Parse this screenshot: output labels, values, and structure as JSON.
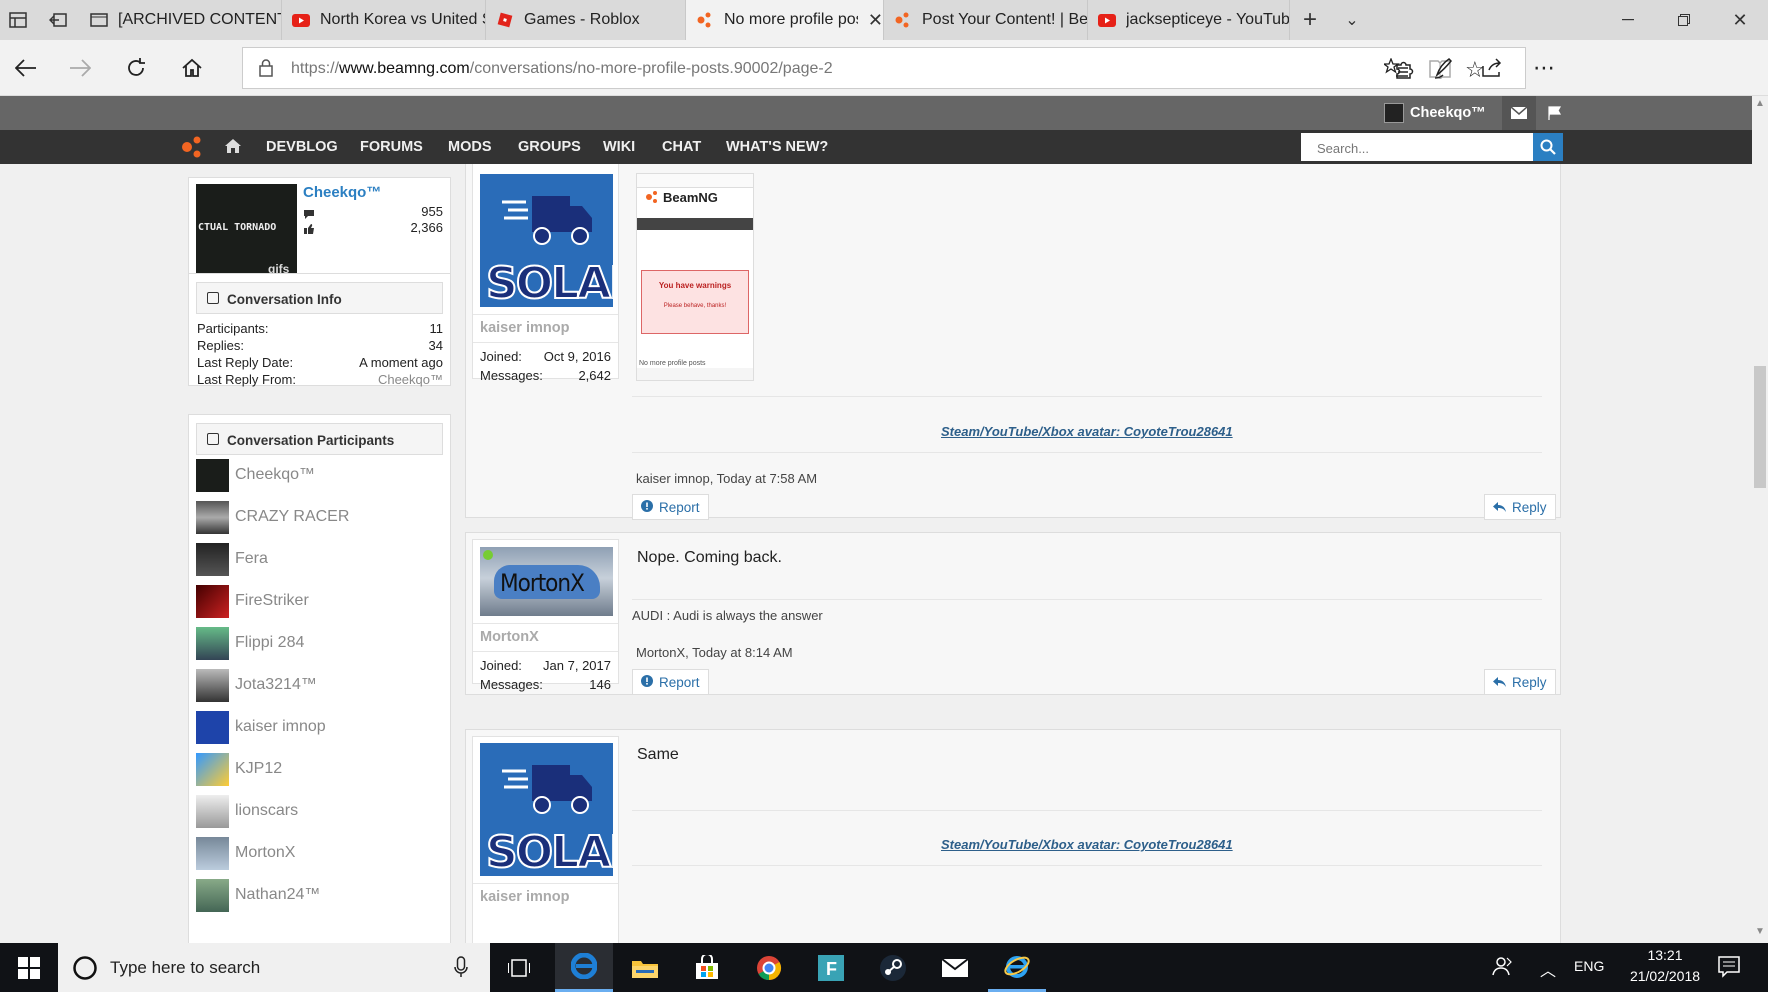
{
  "tabs": [
    {
      "label": "[ARCHIVED CONTENT] E",
      "icon": "page-icon"
    },
    {
      "label": "North Korea vs United St",
      "icon": "youtube-icon"
    },
    {
      "label": "Games - Roblox",
      "icon": "roblox-icon"
    },
    {
      "label": "No more profile post",
      "icon": "beamng-icon",
      "active": true
    },
    {
      "label": "Post Your Content! | Bear",
      "icon": "beamng-icon"
    },
    {
      "label": "jacksepticeye - YouTube",
      "icon": "youtube-icon"
    }
  ],
  "address": {
    "prefix": "https://",
    "domain": "www.beamng.com",
    "path": "/conversations/no-more-profile-posts.90002/page-2"
  },
  "site": {
    "account_name": "Cheekqo™",
    "nav": [
      "DEVBLOG",
      "FORUMS",
      "MODS",
      "GROUPS",
      "WIKI",
      "CHAT",
      "WHAT'S NEW?"
    ],
    "search_placeholder": "Search..."
  },
  "profile": {
    "name": "Cheekqo™",
    "messages": "955",
    "likes": "2,366",
    "avatar_text": "CTUAL TORNADO",
    "avatar_sub": "gifs"
  },
  "conversation_info": {
    "title": "Conversation Info",
    "rows": [
      {
        "label": "Participants:",
        "value": "11"
      },
      {
        "label": "Replies:",
        "value": "34"
      },
      {
        "label": "Last Reply Date:",
        "value": "A moment ago"
      },
      {
        "label": "Last Reply From:",
        "value": "Cheekqo™"
      }
    ]
  },
  "participants": {
    "title": "Conversation Participants",
    "list": [
      "Cheekqo™",
      "CRAZY RACER",
      "Fera",
      "FireStriker",
      "Flippi 284",
      "Jota3214™",
      "kaiser imnop",
      "KJP12",
      "lionscars",
      "MortonX",
      "Nathan24™"
    ]
  },
  "posts": [
    {
      "user": "kaiser imnop",
      "joined_label": "Joined:",
      "joined": "Oct 9, 2016",
      "messages_label": "Messages:",
      "messages": "2,642",
      "avatar": "SOLAR",
      "screenshot": {
        "logo": "BeamNG",
        "warn_title": "You have warnings",
        "warn_text": "Please behave, thanks!",
        "footer": "No more profile posts"
      },
      "signature": "Steam/YouTube/Xbox avatar: CoyoteTrou28641",
      "meta": "kaiser imnop, Today at 7:58 AM",
      "report": "Report",
      "reply": "Reply"
    },
    {
      "user": "MortonX",
      "joined_label": "Joined:",
      "joined": "Jan 7, 2017",
      "messages_label": "Messages:",
      "messages": "146",
      "avatar": "MortonX",
      "text": "Nope. Coming back.",
      "signature": "AUDI : Audi is always the answer",
      "meta": "MortonX, Today at 8:14 AM",
      "report": "Report",
      "reply": "Reply"
    },
    {
      "user": "kaiser imnop",
      "avatar": "SOLAR",
      "text": "Same",
      "signature": "Steam/YouTube/Xbox avatar: CoyoteTrou28641"
    }
  ],
  "taskbar": {
    "search_placeholder": "Type here to search",
    "lang": "ENG",
    "time": "13:21",
    "date": "21/02/2018"
  },
  "colors": {
    "nav_bg": "#333333",
    "top_bg": "#666666",
    "accent": "#2b7fc2",
    "beamng_orange": "#f26522",
    "link": "#2d5f8a"
  }
}
